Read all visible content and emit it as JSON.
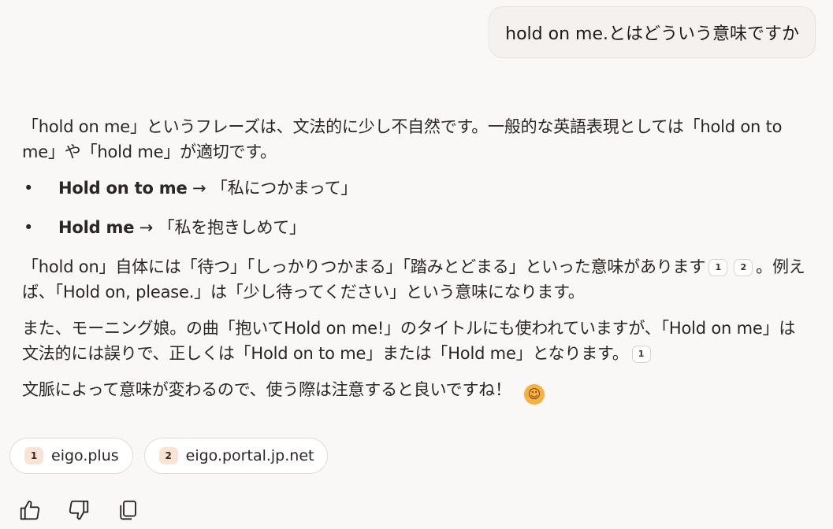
{
  "user_message": "hold on me.とはどういう意味ですか",
  "answer": {
    "intro": "「hold on me」というフレーズは、文法的に少し不自然です。一般的な英語表現としては「hold on to me」や「hold me」が適切です。",
    "bullets": [
      {
        "term": "Hold on to me",
        "arrow": " → ",
        "meaning": "「私につかまって」"
      },
      {
        "term": "Hold me",
        "arrow": " → ",
        "meaning": "「私を抱きしめて」"
      }
    ],
    "para2_a": "「hold on」自体には「待つ」「しっかりつかまる」「踏みとどまる」といった意味があります",
    "para2_cite1": "1",
    "para2_cite2": "2",
    "para2_b": "。例えば、「Hold on, please.」は「少し待ってください」という意味になります。",
    "para3_a": "また、モーニング娘。の曲「抱いてHold on me!」のタイトルにも使われていますが、「Hold on me」は文法的には誤りで、正しくは「Hold on to me」または「Hold me」となります。",
    "para3_cite": "1",
    "para4": "文脈によって意味が変わるので、使う際は注意すると良いですね！",
    "emoji": "☺"
  },
  "sources": [
    {
      "num": "1",
      "label": "eigo.plus"
    },
    {
      "num": "2",
      "label": "eigo.portal.jp.net"
    }
  ],
  "actions": {
    "like_icon": "thumbs-up-icon",
    "dislike_icon": "thumbs-down-icon",
    "copy_icon": "copy-icon"
  }
}
